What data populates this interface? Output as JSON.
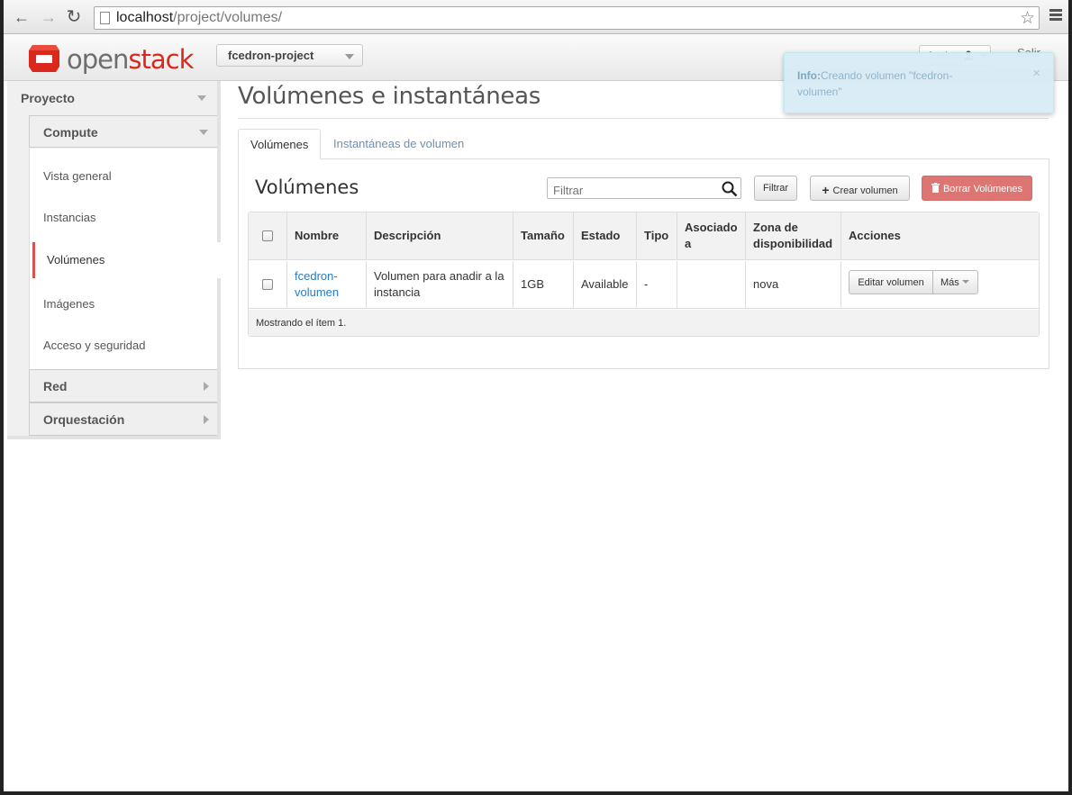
{
  "browser": {
    "url_host": "localhost",
    "url_path": "/project/volumes/"
  },
  "header": {
    "logo_open": "open",
    "logo_stack": "stack",
    "project": "fcedron-project",
    "user": "fcedron",
    "logout": "Salir"
  },
  "sidebar": {
    "dashboard": "Proyecto",
    "compute": "Compute",
    "items": [
      {
        "label": "Vista general"
      },
      {
        "label": "Instancias"
      },
      {
        "label": "Volúmenes"
      },
      {
        "label": "Imágenes"
      },
      {
        "label": "Acceso y seguridad"
      }
    ],
    "network": "Red",
    "orchestration": "Orquestación"
  },
  "main": {
    "page_title": "Volúmenes e instantáneas",
    "tabs": [
      {
        "label": "Volúmenes"
      },
      {
        "label": "Instantáneas de volumen"
      }
    ],
    "table_title": "Volúmenes",
    "filter_placeholder": "Filtrar",
    "filter_button": "Filtrar",
    "create_button": "Crear volumen",
    "delete_button": "Borrar Volúmenes",
    "columns": {
      "name": "Nombre",
      "description": "Descripción",
      "size": "Tamaño",
      "status": "Estado",
      "type": "Tipo",
      "attached_l1": "Asociado",
      "attached_l2": "a",
      "zone_l1": "Zona de",
      "zone_l2": "disponibilidad",
      "actions": "Acciones"
    },
    "rows": [
      {
        "name_l1": "fcedron-",
        "name_l2": "volumen",
        "desc_l1": "Volumen para anadir a la",
        "desc_l2": "instancia",
        "size": "1GB",
        "status": "Available",
        "type": "-",
        "attached": "",
        "zone": "nova",
        "edit_action": "Editar volumen",
        "more_action": "Más"
      }
    ],
    "footer": "Mostrando el ítem 1."
  },
  "alert": {
    "label": "Info:",
    "message_l1": "Creando volumen \"fcedron-",
    "message_l2": "volumen\"",
    "close": "×"
  },
  "colors": {
    "brand_red": "#da291c",
    "danger": "#dd7672",
    "link": "#2a7ac0",
    "info_bg": "#d9edf7"
  }
}
